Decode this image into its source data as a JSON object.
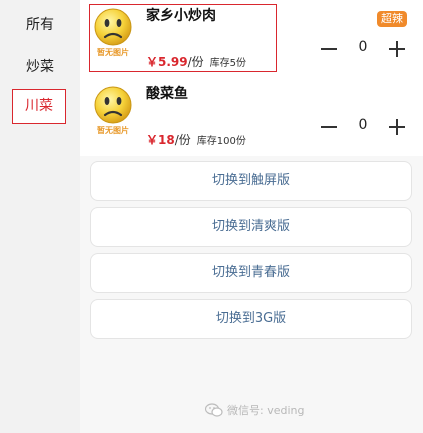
{
  "sidebar": {
    "categories": [
      {
        "label": "所有"
      },
      {
        "label": "炒菜"
      },
      {
        "label": "川菜",
        "selected": true
      }
    ]
  },
  "dishes": [
    {
      "name": "家乡小炒肉",
      "price": "￥5.99",
      "unit": "/份",
      "stock": "库存5份",
      "badge": "超辣",
      "quantity": "0",
      "image_placeholder": "暂无图片"
    },
    {
      "name": "酸菜鱼",
      "price": "￥18",
      "unit": "/份",
      "stock": "库存100份",
      "quantity": "0",
      "image_placeholder": "暂无图片"
    }
  ],
  "switch_buttons": [
    {
      "label": "切换到触屏版"
    },
    {
      "label": "切换到清爽版"
    },
    {
      "label": "切换到青春版"
    },
    {
      "label": "切换到3G版"
    }
  ],
  "watermark": {
    "text": "微信号: veding",
    "icon": "wechat-icon"
  },
  "colors": {
    "accent_red": "#d9272e",
    "badge_orange": "#f08a2b",
    "link_blue": "#4a6d93"
  }
}
